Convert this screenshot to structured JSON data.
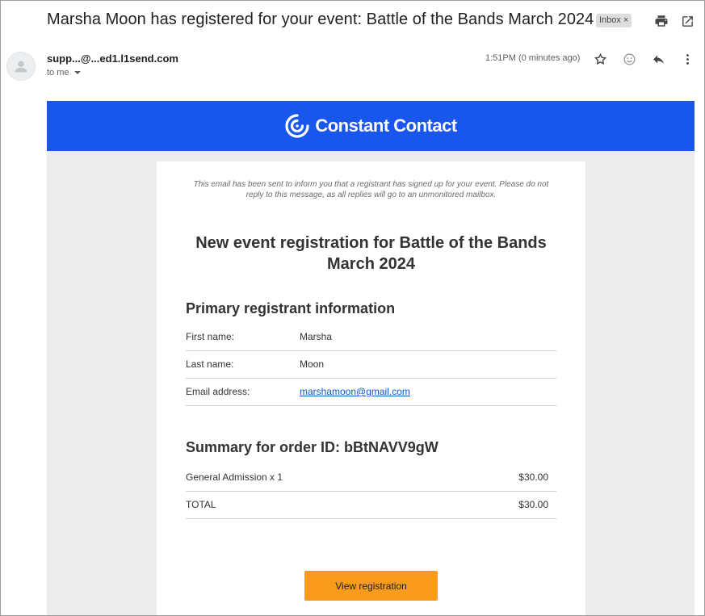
{
  "header": {
    "subject": "Marsha Moon has registered for your event: Battle of the Bands March 2024",
    "label_chip": "Inbox",
    "label_remove": "×"
  },
  "message": {
    "sender": "supp...@...ed1.l1send.com",
    "recipient": "to me",
    "timestamp": "1:51PM (0 minutes ago)"
  },
  "email": {
    "brand": "Constant Contact",
    "notice": "This email has been sent to inform you that a registrant has signed up for your event. Please do not reply to this message, as all replies will go to an unmonitored mailbox.",
    "headline": "New event registration for Battle of the Bands March 2024",
    "registrant_section": "Primary registrant information",
    "registrant": [
      {
        "label": "First name:",
        "value": "Marsha"
      },
      {
        "label": "Last name:",
        "value": "Moon"
      },
      {
        "label": "Email address:",
        "value": "marshamoon@gmail.com"
      }
    ],
    "order_section": "Summary for order ID: bBtNAVV9gW",
    "order": [
      {
        "label": "General Admission x 1",
        "amount": "$30.00"
      },
      {
        "label": "TOTAL",
        "amount": "$30.00"
      }
    ],
    "button": "View registration"
  },
  "colors": {
    "brand_blue": "#1856ed",
    "button_orange": "#f99b1c",
    "link": "#1155cc"
  },
  "icons": [
    "print-icon",
    "open-in-new-icon",
    "avatar-icon",
    "star-icon",
    "emoji-icon",
    "reply-icon",
    "more-vert-icon",
    "constant-contact-logo-icon"
  ]
}
